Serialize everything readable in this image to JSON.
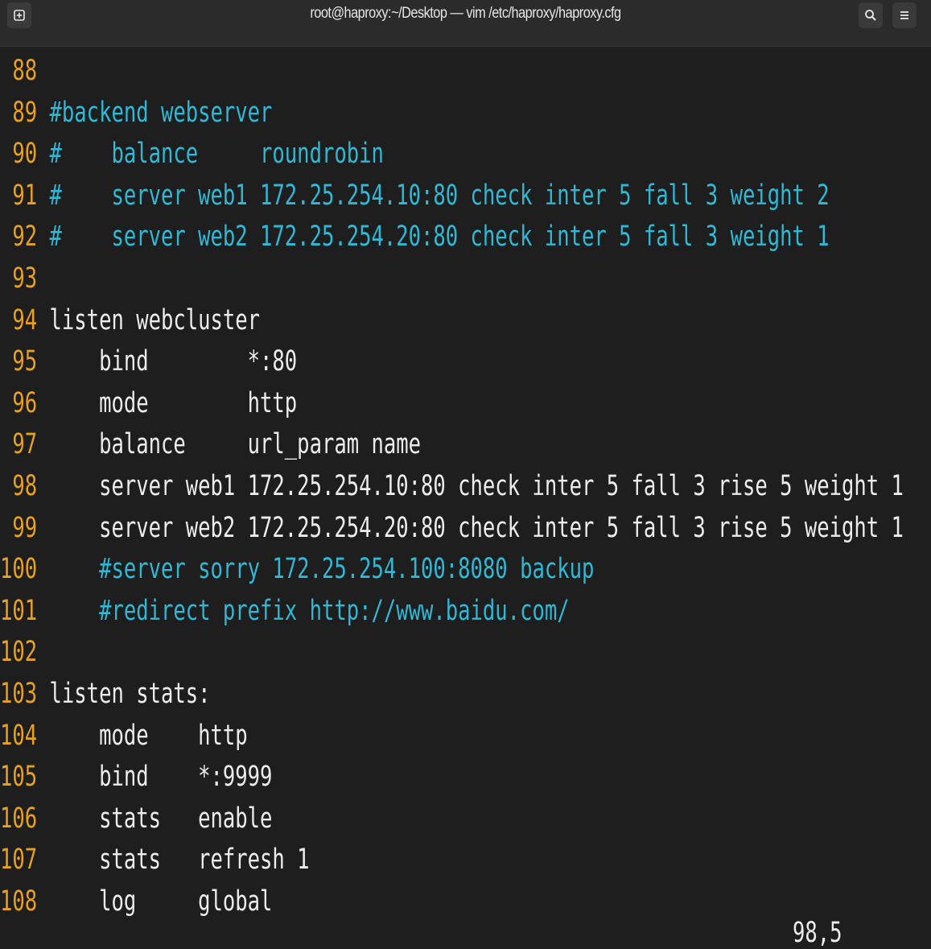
{
  "window": {
    "title": "root@haproxy:~/Desktop — vim /etc/haproxy/haproxy.cfg"
  },
  "colors": {
    "line_number": "#e8a020",
    "comment": "#2fb9d6",
    "text": "#ececec",
    "background": "#1e1e1e"
  },
  "icons": {
    "new_tab": "new-tab-icon",
    "search": "search-icon",
    "menu": "hamburger-menu-icon"
  },
  "lines": [
    {
      "num": "88",
      "text": "",
      "kind": "normal"
    },
    {
      "num": "89",
      "text": "#backend webserver",
      "kind": "comment"
    },
    {
      "num": "90",
      "text": "#    balance     roundrobin",
      "kind": "comment"
    },
    {
      "num": "91",
      "text": "#    server web1 172.25.254.10:80 check inter 5 fall 3 weight 2",
      "kind": "comment"
    },
    {
      "num": "92",
      "text": "#    server web2 172.25.254.20:80 check inter 5 fall 3 weight 1",
      "kind": "comment"
    },
    {
      "num": "93",
      "text": "",
      "kind": "normal"
    },
    {
      "num": "94",
      "text": "listen webcluster",
      "kind": "normal"
    },
    {
      "num": "95",
      "text": "    bind        *:80",
      "kind": "normal"
    },
    {
      "num": "96",
      "text": "    mode        http",
      "kind": "normal"
    },
    {
      "num": "97",
      "text": "    balance     url_param name",
      "kind": "normal"
    },
    {
      "num": "98",
      "text": "    server web1 172.25.254.10:80 check inter 5 fall 3 rise 5 weight 1",
      "kind": "normal"
    },
    {
      "num": "99",
      "text": "    server web2 172.25.254.20:80 check inter 5 fall 3 rise 5 weight 1",
      "kind": "normal"
    },
    {
      "num": "100",
      "text": "    #server sorry 172.25.254.100:8080 backup",
      "kind": "comment"
    },
    {
      "num": "101",
      "text": "    #redirect prefix http://www.baidu.com/",
      "kind": "comment"
    },
    {
      "num": "102",
      "text": "",
      "kind": "normal"
    },
    {
      "num": "103",
      "text": "listen stats:",
      "kind": "normal"
    },
    {
      "num": "104",
      "text": "    mode    http",
      "kind": "normal"
    },
    {
      "num": "105",
      "text": "    bind    *:9999",
      "kind": "normal"
    },
    {
      "num": "106",
      "text": "    stats   enable",
      "kind": "normal"
    },
    {
      "num": "107",
      "text": "    stats   refresh 1",
      "kind": "normal"
    },
    {
      "num": "108",
      "text": "    log     global",
      "kind": "normal"
    }
  ],
  "status": {
    "ruler": "98,5"
  }
}
